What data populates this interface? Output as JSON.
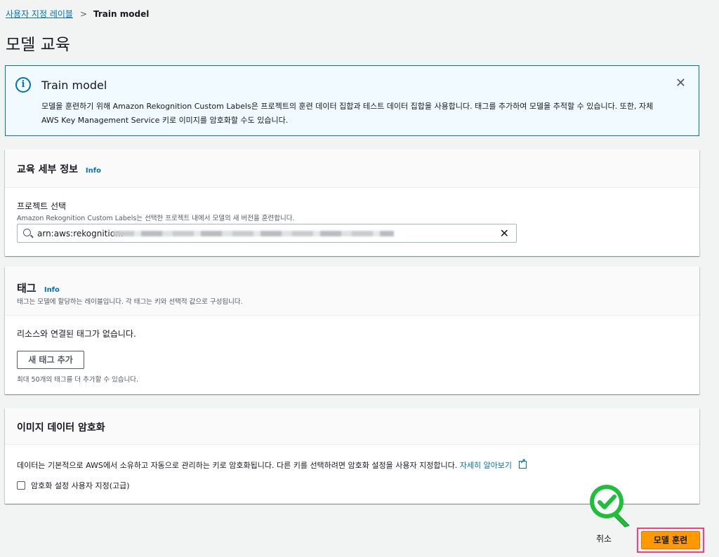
{
  "breadcrumb": {
    "parent": "사용자 지정 레이블",
    "current": "Train model"
  },
  "page": {
    "title": "모델 교육"
  },
  "banner": {
    "icon": "info-icon",
    "title": "Train model",
    "line1": "모델을 훈련하기 위해 Amazon Rekognition Custom Labels은 프로젝트의 훈련 데이터 집합과 테스트 데이터 집합을 사용합니다. 태그를 추가하여 모델을 추적할 수 있습니다. 또한, 자체",
    "line2": "AWS Key Management Service 키로 이미지를 암호화할 수도 있습니다."
  },
  "training_details": {
    "title": "교육 세부 정보",
    "info": "Info",
    "project_label": "프로젝트 선택",
    "project_desc": "Amazon Rekognition Custom Labels는 선택한 프로젝트 내에서 모델의 새 버전을 훈련합니다.",
    "project_value": "arn:aws:rekognition:"
  },
  "tags": {
    "title": "태그",
    "info": "Info",
    "desc": "태그는 모델에 할당하는 레이블입니다. 각 태그는 키와 선택적 값으로 구성됩니다.",
    "empty": "리소스와 연결된 태그가 없습니다.",
    "add_button": "새 태그 추가",
    "limit": "최대 50개의 태그를 더 추가할 수 있습니다."
  },
  "encryption": {
    "title": "이미지 데이터 암호화",
    "text": "데이터는 기본적으로 AWS에서 소유하고 자동으로 관리하는 키로 암호화됩니다. 다른 키를 선택하려면 암호화 설정을 사용자 지정합니다.",
    "link": "자세히 알아보기",
    "checkbox_label": "암호화 설정 사용자 지정(고급)"
  },
  "footer": {
    "cancel": "취소",
    "submit": "모델 훈련"
  },
  "colors": {
    "primary": "#ff9900",
    "link": "#0073bb",
    "highlight": "#ff3c7e",
    "check": "#1fbf3a"
  }
}
